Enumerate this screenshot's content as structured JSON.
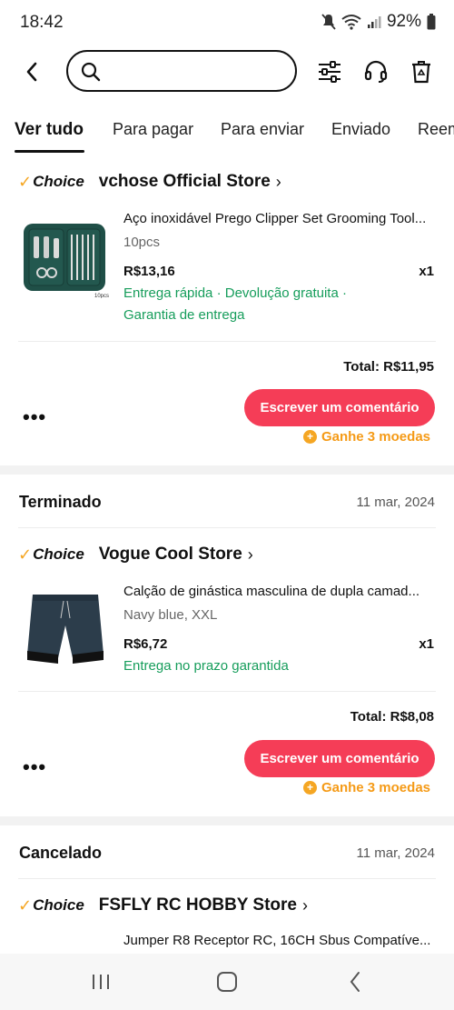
{
  "status_bar": {
    "time": "18:42",
    "battery": "92%"
  },
  "search": {
    "placeholder": ""
  },
  "tabs": [
    {
      "label": "Ver tudo"
    },
    {
      "label": "Para pagar"
    },
    {
      "label": "Para enviar"
    },
    {
      "label": "Enviado"
    },
    {
      "label": "Reem"
    }
  ],
  "orders": [
    {
      "status": "",
      "date": "",
      "choice_label": "Choice",
      "store": "vchose Official Store",
      "product": {
        "title": "Aço inoxidável Prego Clipper Set Grooming Tool...",
        "variant": "10pcs",
        "price": "R$13,16",
        "qty": "x1",
        "tags_line1": "Entrega rápida · Devolução gratuita ·",
        "tags_line2": "Garantia de entrega",
        "img_caption": "10pcs"
      },
      "total": "Total: R$11,95",
      "review_button": "Escrever um comentário",
      "coins": "Ganhe 3 moedas"
    },
    {
      "status": "Terminado",
      "date": "11 mar, 2024",
      "choice_label": "Choice",
      "store": "Vogue Cool Store",
      "product": {
        "title": "Calção de ginástica masculina de dupla camad...",
        "variant": "Navy blue, XXL",
        "price": "R$6,72",
        "qty": "x1",
        "tags_line1": "Entrega no prazo garantida"
      },
      "total": "Total: R$8,08",
      "review_button": "Escrever um comentário",
      "coins": "Ganhe 3 moedas"
    },
    {
      "status": "Cancelado",
      "date": "11 mar, 2024",
      "choice_label": "Choice",
      "store": "FSFLY RC HOBBY Store",
      "product": {
        "title": "Jumper R8 Receptor RC, 16CH Sbus Compatíve..."
      }
    }
  ],
  "more_label": "•••",
  "store_chevron": "›",
  "colors": {
    "accent": "#f53d57",
    "green": "#169d5b",
    "coin": "#f5a623"
  }
}
